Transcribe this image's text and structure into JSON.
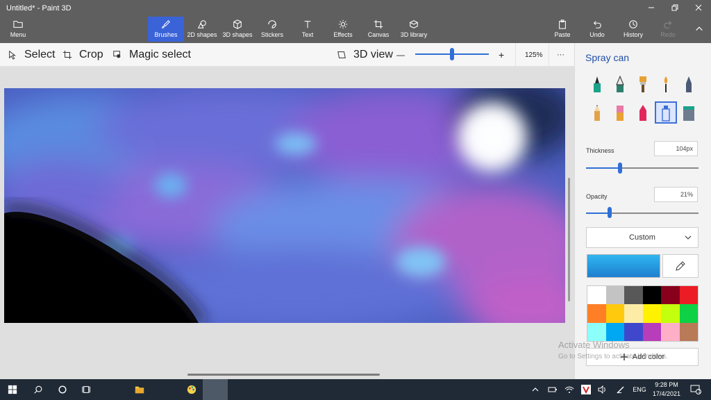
{
  "window": {
    "title": "Untitled* - Paint 3D"
  },
  "ribbon": {
    "menu": "Menu",
    "tabs": [
      {
        "label": "Brushes",
        "icon": "brush-icon"
      },
      {
        "label": "2D shapes",
        "icon": "shapes-2d-icon"
      },
      {
        "label": "3D shapes",
        "icon": "cube-icon"
      },
      {
        "label": "Stickers",
        "icon": "sticker-icon"
      },
      {
        "label": "Text",
        "icon": "text-icon"
      },
      {
        "label": "Effects",
        "icon": "sun-icon"
      },
      {
        "label": "Canvas",
        "icon": "crop-canvas-icon"
      },
      {
        "label": "3D library",
        "icon": "library-icon"
      }
    ],
    "actions": [
      {
        "label": "Paste",
        "icon": "paste-icon"
      },
      {
        "label": "Undo",
        "icon": "undo-icon"
      },
      {
        "label": "History",
        "icon": "history-icon"
      },
      {
        "label": "Redo",
        "icon": "redo-icon"
      }
    ]
  },
  "toolbar": {
    "select": "Select",
    "crop": "Crop",
    "magic_select": "Magic select",
    "view_3d": "3D view",
    "zoom_minus": "—",
    "zoom_plus": "+",
    "zoom_level": "125%",
    "zoom_fraction": 0.5,
    "more": "···"
  },
  "panel": {
    "title": "Spray can",
    "brushes": [
      {
        "name": "marker",
        "color": "#1aa38a"
      },
      {
        "name": "calligraphy-pen",
        "color": "#2f7f6e"
      },
      {
        "name": "oil-brush",
        "color": "#e8a233"
      },
      {
        "name": "watercolor",
        "color": "#e8a233"
      },
      {
        "name": "pixel-pen",
        "color": "#4d5a77"
      },
      {
        "name": "pencil",
        "color": "#e2a248"
      },
      {
        "name": "eraser",
        "color": "#e87aa6"
      },
      {
        "name": "crayon",
        "color": "#e0285b"
      },
      {
        "name": "spray-can",
        "color": "#3c6bd8"
      },
      {
        "name": "fill",
        "color": "#1aa38a"
      }
    ],
    "thickness_label": "Thickness",
    "thickness_value": "104px",
    "thickness_fraction": 0.3,
    "opacity_label": "Opacity",
    "opacity_value": "21%",
    "opacity_fraction": 0.21,
    "color_mode": "Custom",
    "swatches": [
      "#ffffff",
      "#c3c3c3",
      "#585858",
      "#000000",
      "#88001b",
      "#ec1c24",
      "#ff7f27",
      "#ffc90e",
      "#fdeca6",
      "#fff200",
      "#c4ff0e",
      "#0ed145",
      "#8cfffb",
      "#00a8f3",
      "#3f48cc",
      "#b83dba",
      "#ffaec8",
      "#b97a57"
    ],
    "add_color": "Add color"
  },
  "watermark": {
    "line1": "Activate Windows",
    "line2": "Go to Settings to activate Windows."
  },
  "taskbar": {
    "lang": "ENG",
    "time": "9:28 PM",
    "date": "17/4/2021",
    "notif_count": "1"
  }
}
